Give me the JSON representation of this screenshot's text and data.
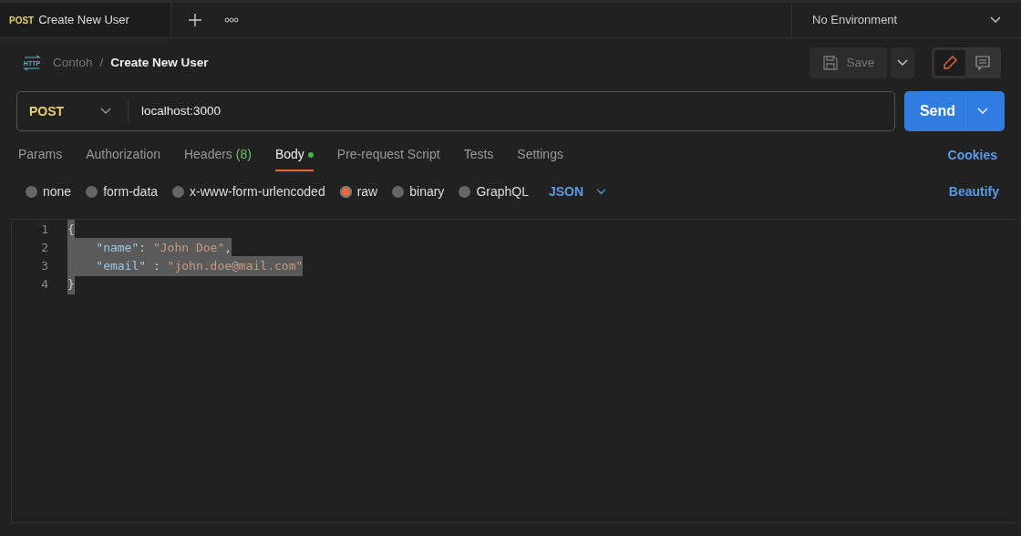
{
  "request_tab": {
    "method": "POST",
    "title": "Create New User"
  },
  "environment": {
    "label": "No Environment"
  },
  "breadcrumb": {
    "badge": "HTTP",
    "collection": "Contoh",
    "separator": "/",
    "request": "Create New User"
  },
  "save_button": {
    "label": "Save",
    "disabled": true
  },
  "view_toggle": [
    {
      "kind": "edit",
      "selected": true
    },
    {
      "kind": "comments",
      "selected": false
    }
  ],
  "url_bar": {
    "method": "POST",
    "url": "localhost:3000"
  },
  "send_button": {
    "label": "Send"
  },
  "tabs": [
    {
      "label": "Params",
      "selected": false
    },
    {
      "label": "Authorization",
      "selected": false
    },
    {
      "label": "Headers",
      "count": "(8)",
      "selected": false
    },
    {
      "label": "Body",
      "dot": true,
      "selected": true
    },
    {
      "label": "Pre-request Script",
      "selected": false
    },
    {
      "label": "Tests",
      "selected": false
    },
    {
      "label": "Settings",
      "selected": false
    }
  ],
  "cookies_link": "Cookies",
  "body_types": [
    {
      "label": "none",
      "selected": false
    },
    {
      "label": "form-data",
      "selected": false
    },
    {
      "label": "x-www-form-urlencoded",
      "selected": false
    },
    {
      "label": "raw",
      "selected": true
    },
    {
      "label": "binary",
      "selected": false
    },
    {
      "label": "GraphQL",
      "selected": false
    }
  ],
  "format_select": "JSON",
  "beautify_link": "Beautify",
  "editor": {
    "lines": [
      {
        "number": "1",
        "selected": true,
        "tokens": [
          {
            "kind": "punct",
            "text": "{"
          }
        ]
      },
      {
        "number": "2",
        "selected": true,
        "indent": true,
        "tokens": [
          {
            "kind": "key",
            "text": "\"name\""
          },
          {
            "kind": "punct",
            "text": ": "
          },
          {
            "kind": "string",
            "text": "\"John Doe\""
          },
          {
            "kind": "punct",
            "text": ","
          }
        ]
      },
      {
        "number": "3",
        "selected": true,
        "indent": true,
        "tokens": [
          {
            "kind": "key",
            "text": "\"email\""
          },
          {
            "kind": "punct",
            "text": " : "
          },
          {
            "kind": "string",
            "text": "\"john.doe@mail.com\""
          }
        ]
      },
      {
        "number": "4",
        "selected": true,
        "tokens": [
          {
            "kind": "punct",
            "text": "}"
          }
        ]
      }
    ]
  }
}
